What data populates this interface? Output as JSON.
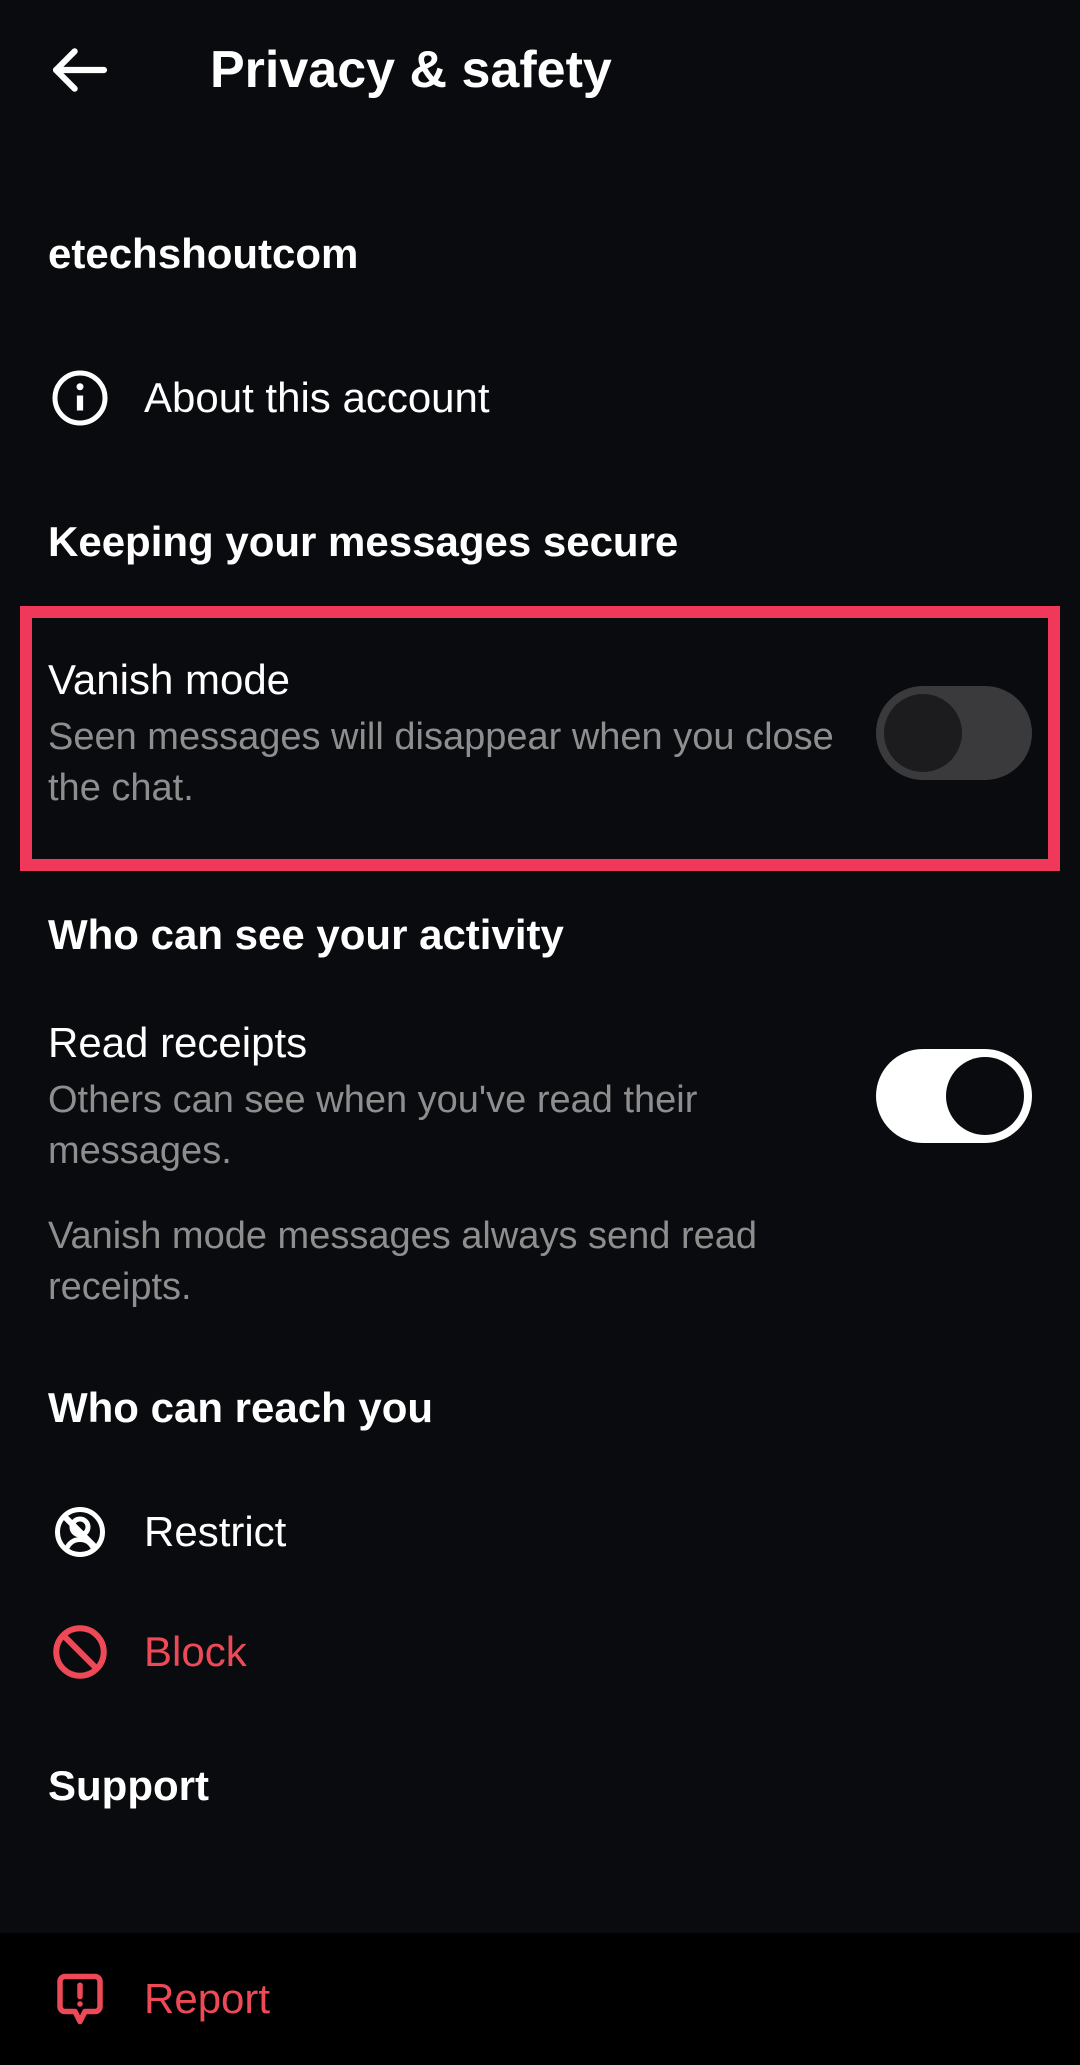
{
  "header": {
    "title": "Privacy & safety"
  },
  "account": {
    "username": "etechshoutcom",
    "about_label": "About this account"
  },
  "sections": {
    "secure_header": "Keeping your messages secure",
    "activity_header": "Who can see your activity",
    "reach_header": "Who can reach you",
    "support_header": "Support"
  },
  "vanish": {
    "title": "Vanish mode",
    "desc": "Seen messages will disappear when you close the chat.",
    "enabled": false
  },
  "read_receipts": {
    "title": "Read receipts",
    "desc1": "Others can see when you've read their messages.",
    "desc2": "Vanish mode messages always send read receipts.",
    "enabled": true
  },
  "reach": {
    "restrict_label": "Restrict",
    "block_label": "Block"
  },
  "support": {
    "report_label": "Report"
  },
  "colors": {
    "danger": "#ed4956",
    "highlight": "#f0385a"
  }
}
